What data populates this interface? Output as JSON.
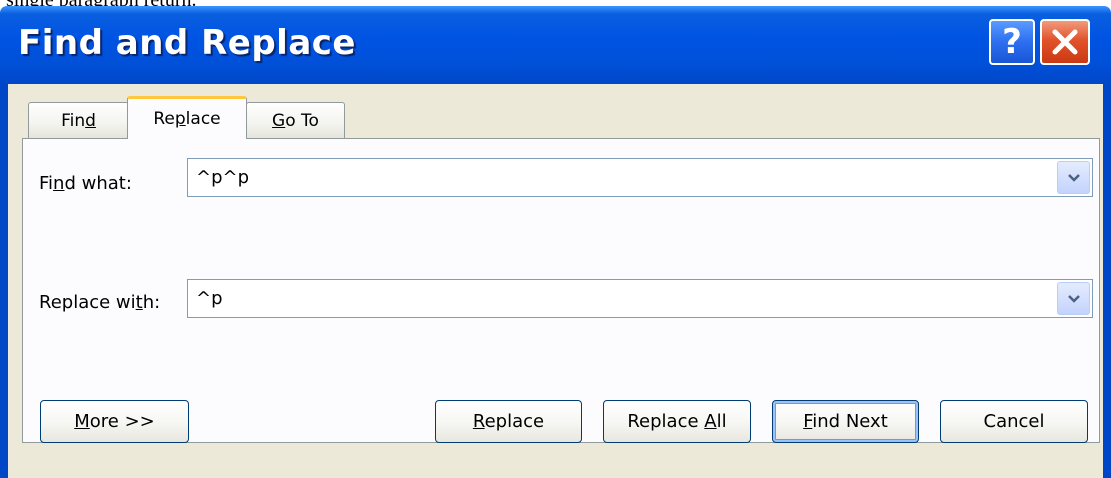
{
  "cropped_text_above": "single paragraph return.",
  "window": {
    "title": "Find and Replace",
    "help_label": "?",
    "close_icon": "close-icon"
  },
  "tabs": [
    {
      "label_pre": "Fin",
      "label_key": "d",
      "label_post": "",
      "active": false
    },
    {
      "label_pre": "Re",
      "label_key": "p",
      "label_post": "lace",
      "active": true
    },
    {
      "label_pre": "",
      "label_key": "G",
      "label_post": "o To",
      "active": false
    }
  ],
  "find": {
    "label_pre": "Fi",
    "label_key": "n",
    "label_post": "d what:",
    "value": "^p^p"
  },
  "replace": {
    "label_pre": "Replace wi",
    "label_key": "t",
    "label_post": "h:",
    "value": "^p"
  },
  "buttons": {
    "more": {
      "pre": "",
      "key": "M",
      "post": "ore >>"
    },
    "replace": {
      "pre": "",
      "key": "R",
      "post": "eplace"
    },
    "replace_all": {
      "pre": "Replace ",
      "key": "A",
      "post": "ll"
    },
    "find_next": {
      "pre": "",
      "key": "F",
      "post": "ind Next"
    },
    "cancel": {
      "pre": "Cancel",
      "key": "",
      "post": ""
    }
  },
  "colors": {
    "titlebar": "#0054e3",
    "client": "#ece9d8",
    "active_tab_accent": "#ffc83c",
    "close_button": "#e2532b"
  }
}
